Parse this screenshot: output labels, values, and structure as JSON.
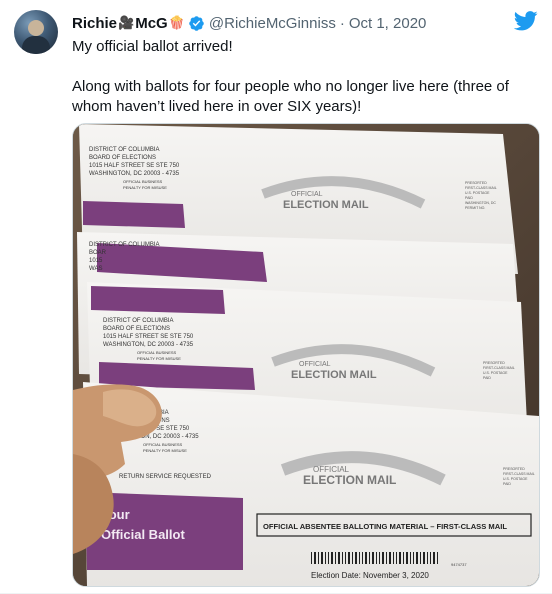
{
  "tweet": {
    "author_name_first": "Richie",
    "author_name_second": "McG",
    "emoji_camera": "🎥",
    "emoji_popcorn": "🍿",
    "handle": "@RichieMcGinniss",
    "separator": "·",
    "date": "Oct 1, 2020",
    "text_line1": "My official ballot arrived!",
    "text_line2": "Along with ballots for four people who no longer live here (three of whom haven’t lived here in over SIX years)!"
  },
  "photo": {
    "return_address": {
      "line1": "DISTRICT OF COLUMBIA",
      "line2": "BOARD OF ELECTIONS",
      "line3": "1015 HALF STREET SE STE 750",
      "line4": "WASHINGTON, DC 20003 - 4735",
      "line5": "OFFICIAL BUSINESS",
      "line6": "PENALTY FOR MISUSE"
    },
    "partial_address": {
      "a1": "DISTRICT OF COLUMBIA",
      "a2": "BOAR",
      "a3": "1015",
      "a4": "WAS",
      "b1": "BIA",
      "b2": "IONS",
      "b3": "EET SE STE 750",
      "b4": "TON, DC 20003 - 4735",
      "b5": "OFFICIAL BUSINESS",
      "b6": "PENALTY FOR MISUSE"
    },
    "seal_official": "OFFICIAL",
    "seal_title": "ELECTION MAIL",
    "return_service": "RETURN SERVICE REQUESTED",
    "ballot_label_1": "Your",
    "ballot_label_2": "Official Ballot",
    "absentee_banner": "OFFICIAL ABSENTEE BALLOTING MATERIAL – FIRST-CLASS MAIL",
    "election_date": "Election Date: November 3, 2020",
    "postage_1": "PRESORTED",
    "postage_2": "FIRST-CLASS MAIL",
    "postage_3": "U.S. POSTAGE",
    "postage_4": "PAID",
    "postage_5": "WASHINGTON, DC",
    "postage_6": "PERMIT NO.",
    "barcode_number": "9474737"
  },
  "colors": {
    "purple": "#7b3f7d",
    "envelope": "#f2f1ef",
    "twitter_blue": "#1d9bf0"
  },
  "icons": {
    "verified": "verified-badge-icon",
    "twitter": "twitter-bird-icon"
  }
}
